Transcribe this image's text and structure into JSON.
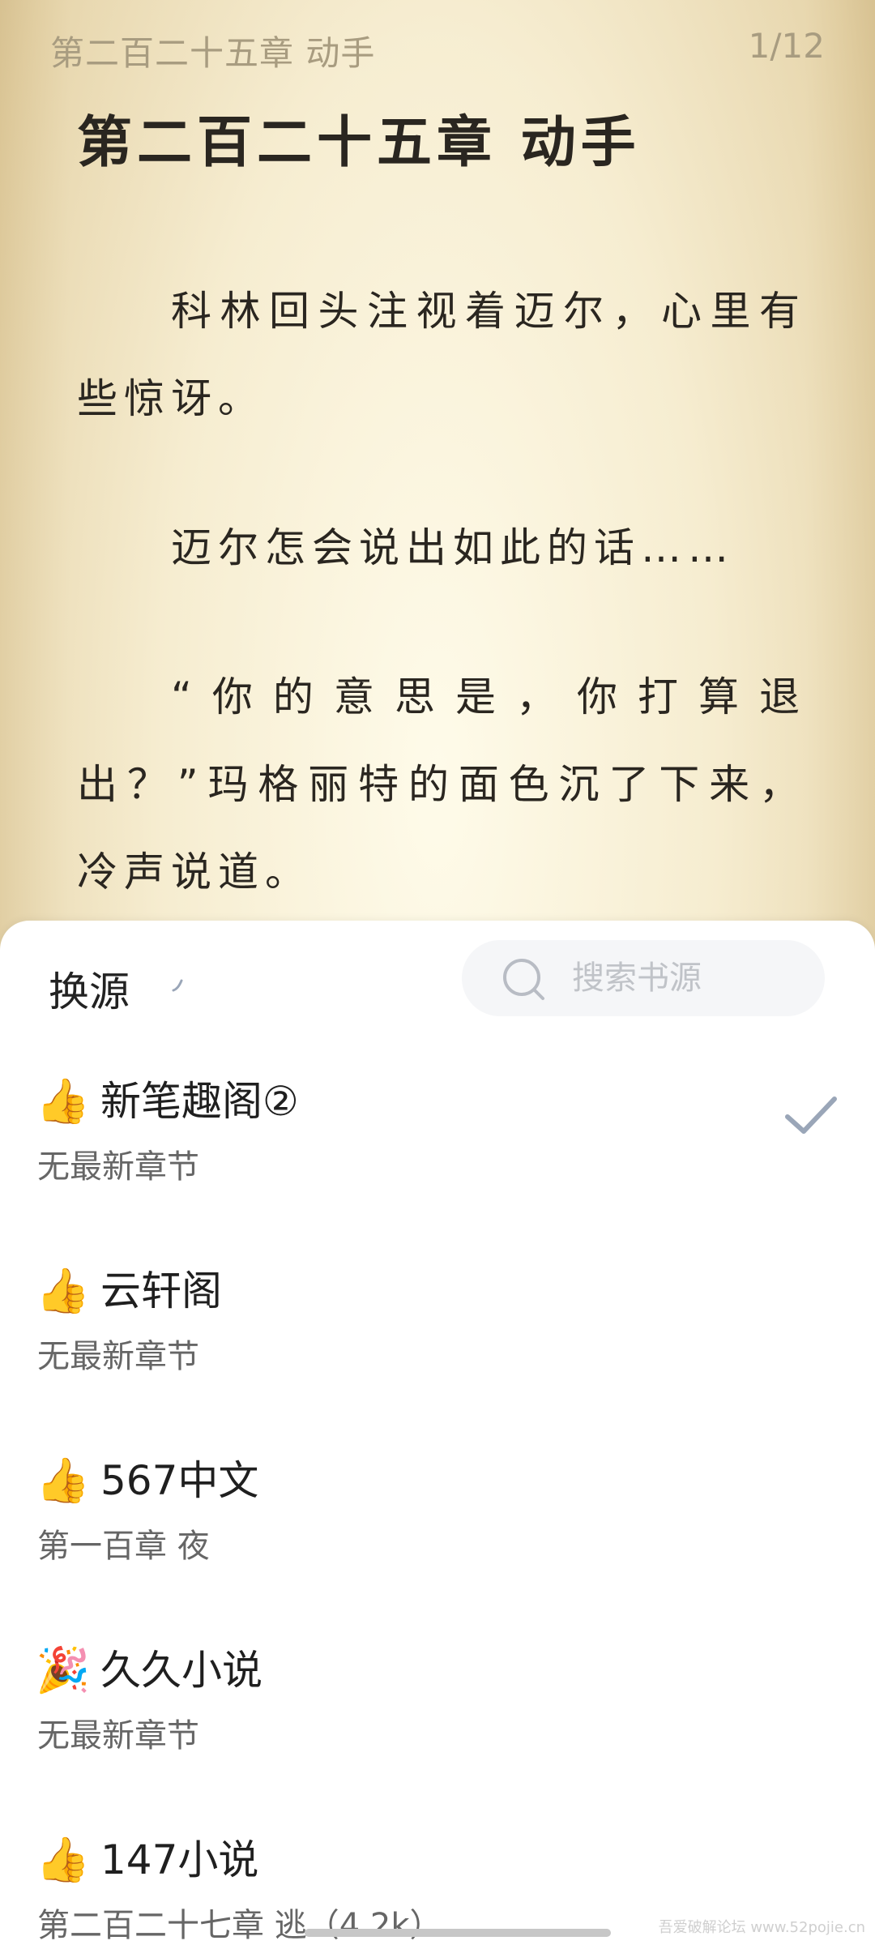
{
  "reader": {
    "header_chapter": "第二百二十五章 动手",
    "page_indicator": "1/12",
    "chapter_title": "第二百二十五章  动手",
    "paragraphs": [
      "科林回头注视着迈尔，心里有些惊讶。",
      "迈尔怎会说出如此的话……",
      "“你的意思是，你打算退出？”玛格丽特的面色沉了下来，冷声说道。"
    ]
  },
  "sheet": {
    "title": "换源",
    "search_placeholder": "搜索书源",
    "sources": [
      {
        "badge": "👍",
        "name": "新笔趣阁②",
        "latest": "无最新章节",
        "selected": true
      },
      {
        "badge": "👍",
        "name": "云轩阁",
        "latest": "无最新章节",
        "selected": false
      },
      {
        "badge": "👍",
        "name": "567中文",
        "latest": "第一百章 夜",
        "selected": false
      },
      {
        "badge": "🎉",
        "name": "久久小说",
        "latest": "无最新章节",
        "selected": false
      },
      {
        "badge": "👍",
        "name": "147小说",
        "latest": "第二百二十七章 逃（4.2k）",
        "selected": false
      }
    ],
    "accent_color": "#9aa6b8"
  },
  "watermark": "吾爱破解论坛 www.52pojie.cn"
}
